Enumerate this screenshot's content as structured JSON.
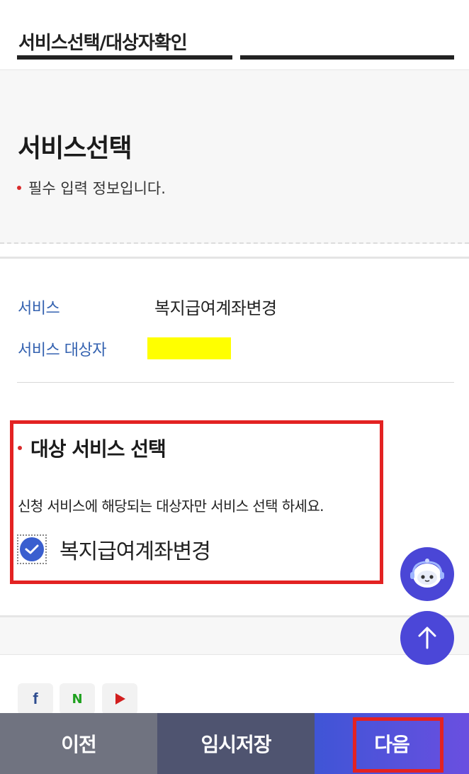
{
  "header": {
    "title": "서비스선택/대상자확인"
  },
  "section": {
    "title": "서비스선택",
    "required_note": "필수 입력 정보입니다."
  },
  "info": {
    "service_label": "서비스",
    "service_value": "복지급여계좌변경",
    "target_label": "서비스 대상자",
    "target_value": ""
  },
  "selection": {
    "title": "대상 서비스 선택",
    "description": "신청 서비스에 해당되는 대상자만 서비스 선택 하세요.",
    "option_label": "복지급여계좌변경",
    "option_checked": true
  },
  "social": {
    "facebook": "f",
    "naver": "N",
    "youtube_icon": "play-icon"
  },
  "bottom": {
    "prev_label": "이전",
    "save_label": "임시저장",
    "next_label": "다음"
  },
  "colors": {
    "accent": "#3462b0",
    "highlight": "#ffff00",
    "alert_red": "#e32222",
    "fab": "#4b47d8"
  }
}
